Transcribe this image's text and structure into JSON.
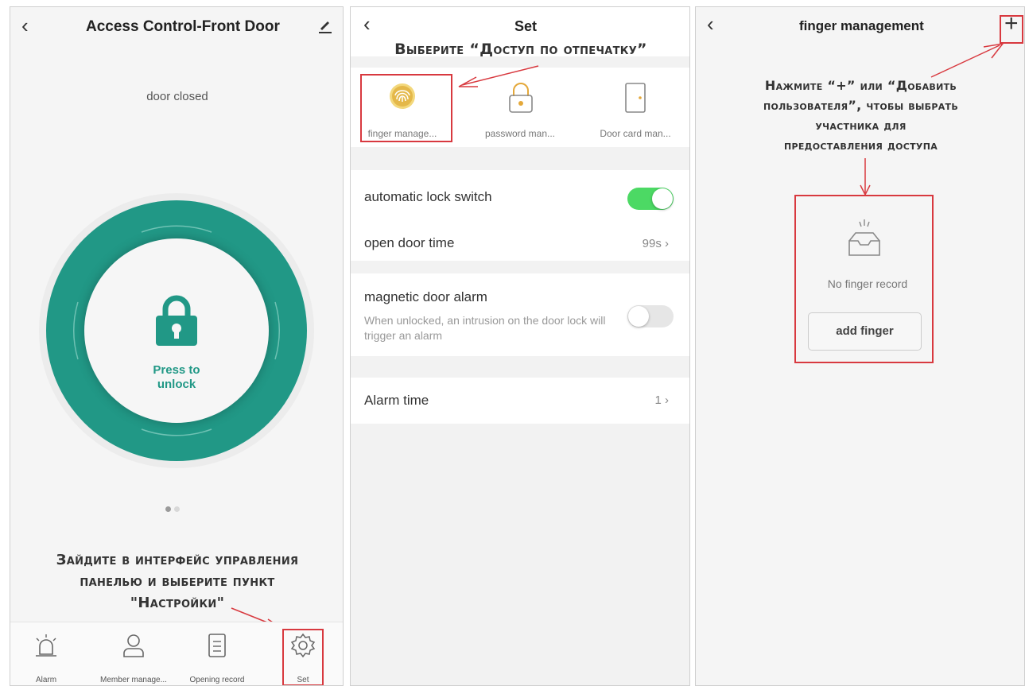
{
  "panel1": {
    "title": "Access Control-Front Door",
    "door_status": "door closed",
    "unlock_label_line1": "Press to",
    "unlock_label_line2": "unlock",
    "callout_line1": "Зайдите в интерфейс управления",
    "callout_line2": "панелью и выберите пункт",
    "callout_line3": "\"Настройки\"",
    "tabs": [
      {
        "label": "Alarm",
        "icon": "alarm-bell-icon"
      },
      {
        "label": "Member manage...",
        "icon": "member-icon"
      },
      {
        "label": "Opening record",
        "icon": "record-icon"
      },
      {
        "label": "Set",
        "icon": "gear-icon"
      }
    ]
  },
  "panel2": {
    "title": "Set",
    "callout": "Выберите “Доступ по отпечатку”",
    "cards": [
      {
        "label": "finger manage...",
        "icon": "fingerprint-icon"
      },
      {
        "label": "password man...",
        "icon": "padlock-icon"
      },
      {
        "label": "Door card man...",
        "icon": "door-icon"
      }
    ],
    "auto_lock_label": "automatic lock switch",
    "auto_lock_on": true,
    "open_door_time_label": "open door time",
    "open_door_time_value": "99s",
    "magnetic_alarm_label": "magnetic door alarm",
    "magnetic_alarm_desc": "When unlocked, an intrusion on the door lock will trigger an alarm",
    "magnetic_alarm_on": false,
    "alarm_time_label": "Alarm time",
    "alarm_time_value": "1"
  },
  "panel3": {
    "title": "finger management",
    "add_symbol": "+",
    "callout_line1": "Нажмите “+” или “Добавить",
    "callout_line2": "пользователя”, чтобы выбрать",
    "callout_line3": "участника для",
    "callout_line4": "предоставления доступа",
    "empty_text": "No finger record",
    "add_button_label": "add finger"
  },
  "colors": {
    "teal": "#219886",
    "toggle_on": "#4cd964",
    "annotation_red": "#d8393f"
  }
}
